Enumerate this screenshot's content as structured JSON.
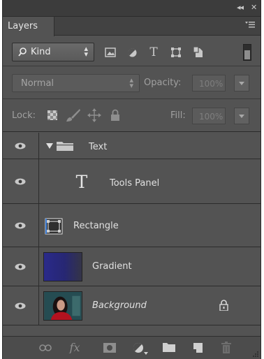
{
  "titlebar": {
    "collapse": "◂◂",
    "close": "✕"
  },
  "tab": {
    "label": "Layers"
  },
  "filter": {
    "kind_label": "Kind"
  },
  "blend": {
    "mode": "Normal",
    "opacity_label": "Opacity:",
    "opacity_value": "100%"
  },
  "lock": {
    "label": "Lock:",
    "fill_label": "Fill:",
    "fill_value": "100%"
  },
  "layers": [
    {
      "name": "Text",
      "type": "group",
      "visible": true,
      "expanded": true
    },
    {
      "name": "Tools Panel",
      "type": "text",
      "visible": true
    },
    {
      "name": "Rectangle",
      "type": "shape",
      "visible": true
    },
    {
      "name": "Gradient",
      "type": "pixel",
      "visible": true
    },
    {
      "name": "Background",
      "type": "background",
      "visible": true,
      "locked": true
    }
  ],
  "colors": {
    "panel_bg": "#535353",
    "dark_bg": "#3c3c3c",
    "text": "#e0e0e0",
    "gradient_thumb": "#2a2a8a"
  }
}
